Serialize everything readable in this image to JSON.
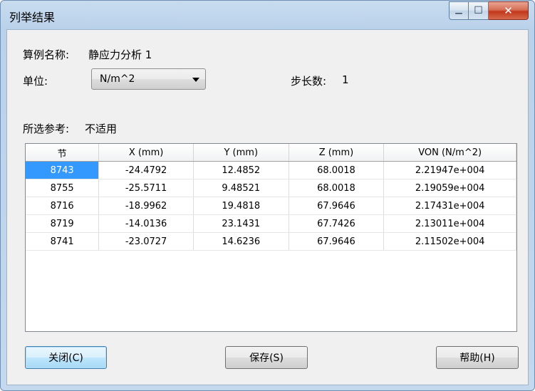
{
  "window": {
    "title": "列举结果",
    "min_glyph": "—",
    "max_glyph": "☐",
    "close_glyph": "✕"
  },
  "form": {
    "study_label": "算例名称:",
    "study_name": "静应力分析 1",
    "unit_label": "单位:",
    "unit_value": "N/m^2",
    "step_label": "步长数:",
    "step_value": "1",
    "ref_label": "所选参考:",
    "ref_value": "不适用"
  },
  "table": {
    "columns": [
      "节",
      "X (mm)",
      "Y (mm)",
      "Z (mm)",
      "VON (N/m^2)"
    ],
    "rows": [
      [
        "8743",
        "-24.4792",
        "12.4852",
        "68.0018",
        "2.21947e+004"
      ],
      [
        "8755",
        "-25.5711",
        "9.48521",
        "68.0018",
        "2.19059e+004"
      ],
      [
        "8716",
        "-18.9962",
        "19.4818",
        "67.9646",
        "2.17431e+004"
      ],
      [
        "8719",
        "-14.0136",
        "23.1431",
        "67.7426",
        "2.13011e+004"
      ],
      [
        "8741",
        "-23.0727",
        "14.6236",
        "67.9646",
        "2.11502e+004"
      ]
    ]
  },
  "buttons": {
    "close": "关闭(C)",
    "save": "保存(S)",
    "help": "帮助(H)"
  },
  "colors": {
    "selection": "#3399ff",
    "titlebar": "#b9d1ea",
    "close_button": "#c2371c"
  }
}
